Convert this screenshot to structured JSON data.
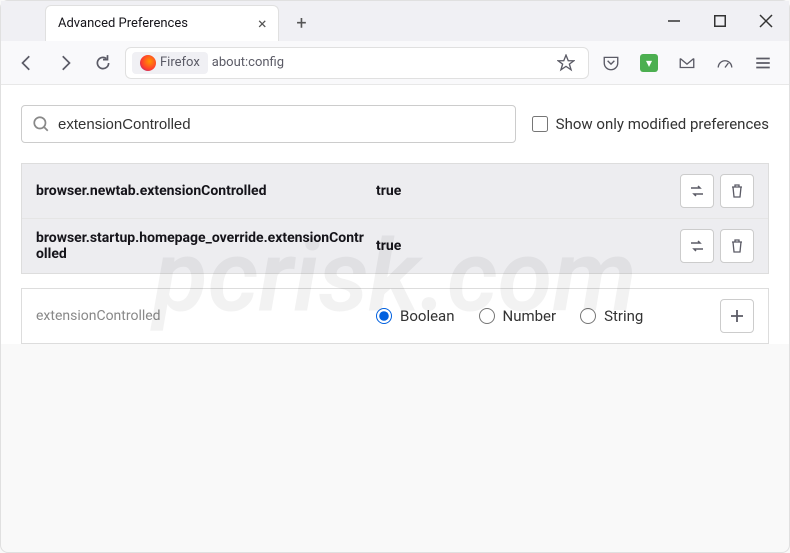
{
  "window": {
    "tab_title": "Advanced Preferences"
  },
  "address": {
    "identity": "Firefox",
    "url": "about:config"
  },
  "config": {
    "search_value": "extensionControlled",
    "show_modified_label": "Show only modified preferences",
    "prefs": [
      {
        "name": "browser.newtab.extensionControlled",
        "value": "true"
      },
      {
        "name": "browser.startup.homepage_override.extensionControlled",
        "value": "true"
      }
    ],
    "new_pref_name": "extensionControlled",
    "type_options": {
      "boolean": "Boolean",
      "number": "Number",
      "string": "String"
    },
    "selected_type": "boolean"
  },
  "watermark": "pcrisk.com"
}
